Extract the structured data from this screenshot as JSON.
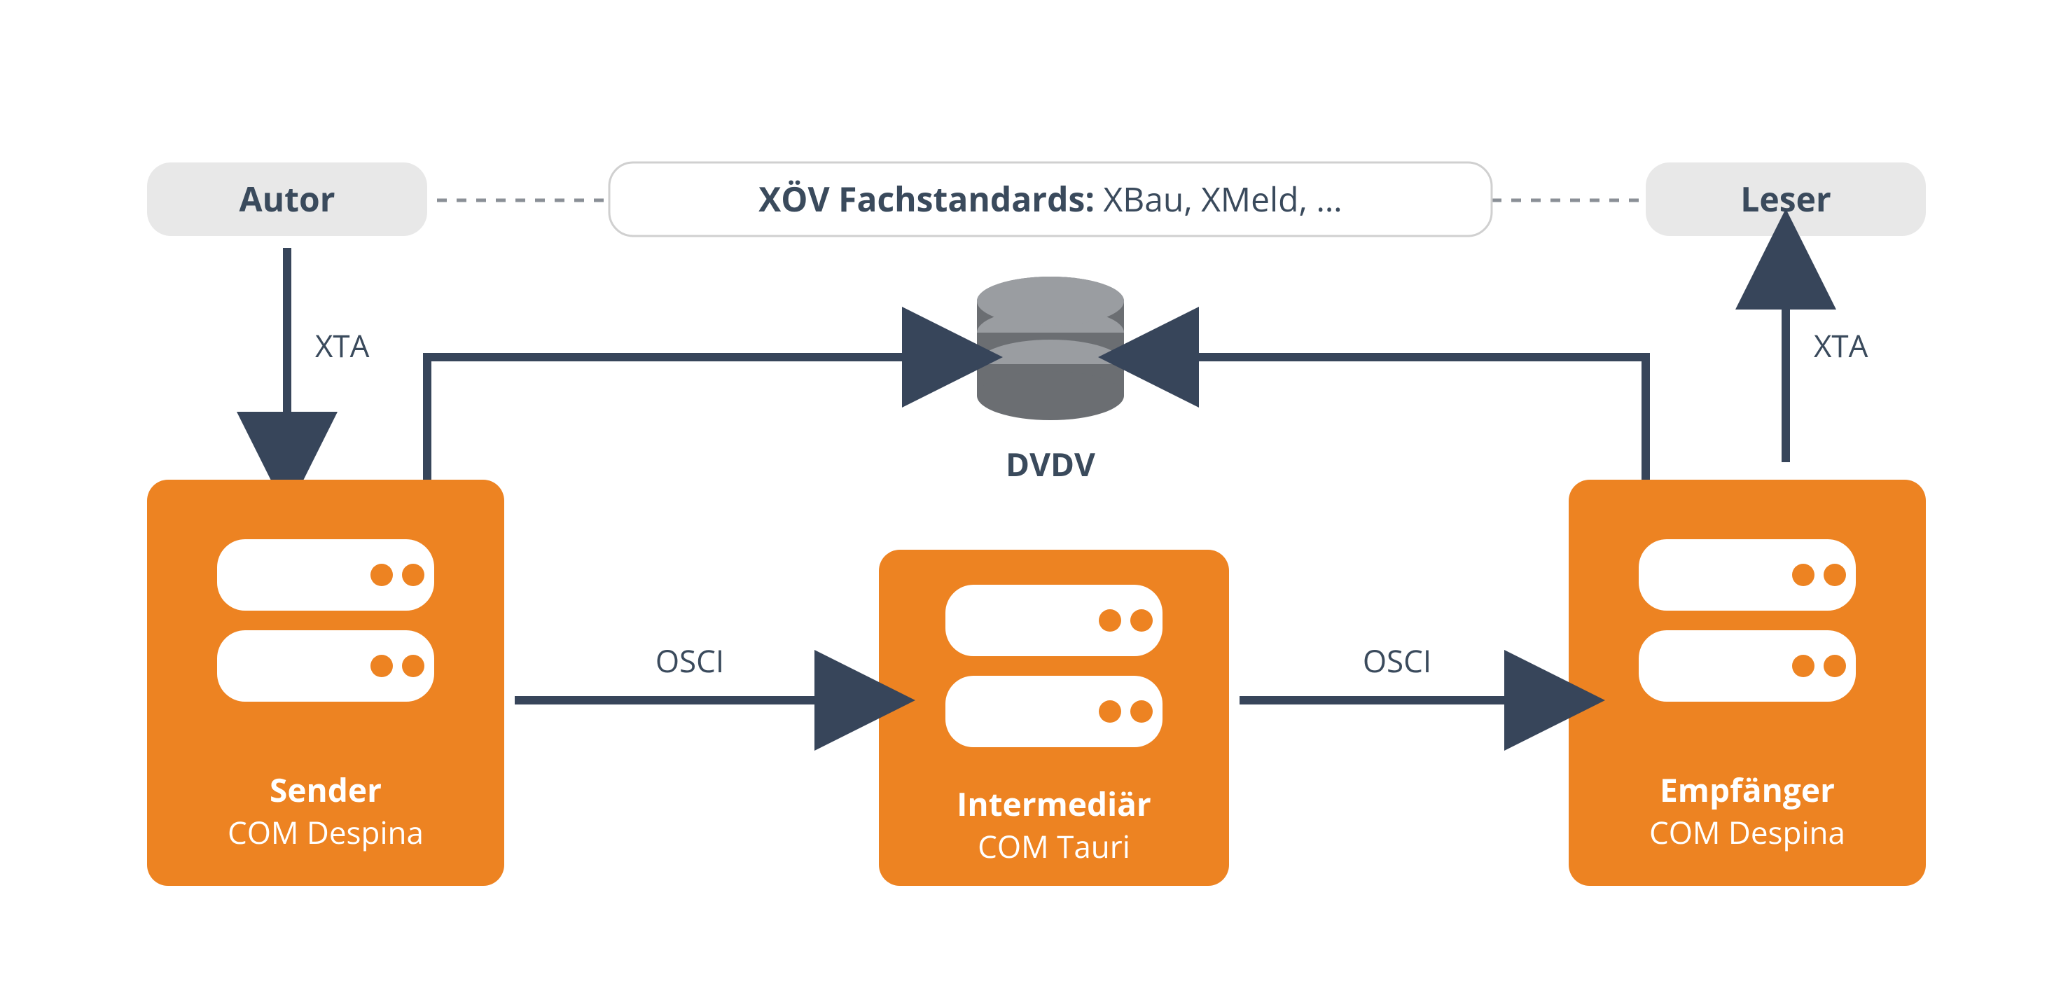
{
  "top": {
    "autor": "Autor",
    "leser": "Leser",
    "standards_bold": "XÖV Fachstandards:",
    "standards_rest": " XBau, XMeld, …"
  },
  "edges": {
    "xta_left": "XTA",
    "xta_right": "XTA",
    "osci_left": "OSCI",
    "osci_right": "OSCI",
    "dvdv": "DVDV"
  },
  "nodes": {
    "sender_title": "Sender",
    "sender_sub": "COM Despina",
    "intermed_title": "Intermediär",
    "intermed_sub": "COM Tauri",
    "empf_title": "Empfänger",
    "empf_sub": "COM Despina"
  },
  "colors": {
    "accent": "#ed8322",
    "dark": "#37455a",
    "pill": "#e8e8e8"
  }
}
